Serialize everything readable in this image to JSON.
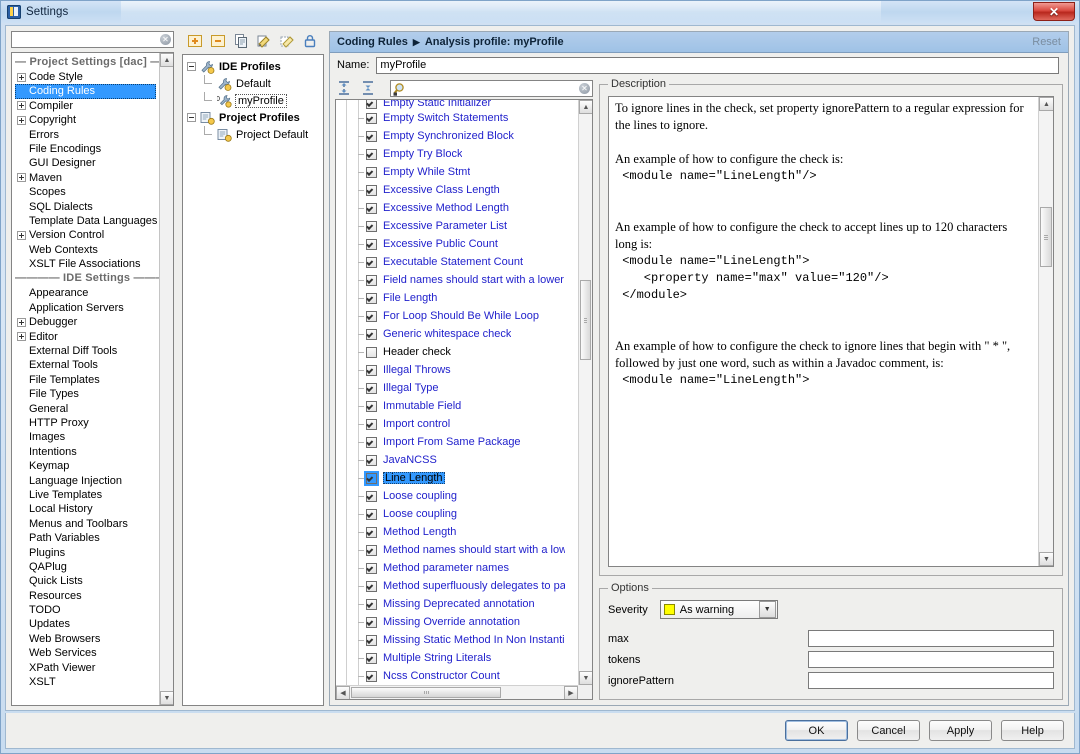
{
  "window": {
    "title": "Settings",
    "app_icon": "intellij-icon",
    "close_label": "✕"
  },
  "sidebar": {
    "search": {
      "value": "",
      "placeholder": ""
    },
    "clear_icon": "clear-circle-icon",
    "group_header_project": "— Project Settings [dac] —",
    "group_header_ide": "———— IDE Settings ————",
    "project_items": [
      {
        "label": "Code Style",
        "expandable": true,
        "selected": false
      },
      {
        "label": "Coding Rules",
        "expandable": false,
        "selected": true
      },
      {
        "label": "Compiler",
        "expandable": true,
        "selected": false
      },
      {
        "label": "Copyright",
        "expandable": true,
        "selected": false
      },
      {
        "label": "Errors",
        "expandable": false,
        "selected": false
      },
      {
        "label": "File Encodings",
        "expandable": false,
        "selected": false
      },
      {
        "label": "GUI Designer",
        "expandable": false,
        "selected": false
      },
      {
        "label": "Maven",
        "expandable": true,
        "selected": false
      },
      {
        "label": "Scopes",
        "expandable": false,
        "selected": false
      },
      {
        "label": "SQL Dialects",
        "expandable": false,
        "selected": false
      },
      {
        "label": "Template Data Languages",
        "expandable": false,
        "selected": false
      },
      {
        "label": "Version Control",
        "expandable": true,
        "selected": false
      },
      {
        "label": "Web Contexts",
        "expandable": false,
        "selected": false
      },
      {
        "label": "XSLT File Associations",
        "expandable": false,
        "selected": false
      }
    ],
    "ide_items": [
      {
        "label": "Appearance",
        "expandable": false
      },
      {
        "label": "Application Servers",
        "expandable": false
      },
      {
        "label": "Debugger",
        "expandable": true
      },
      {
        "label": "Editor",
        "expandable": true
      },
      {
        "label": "External Diff Tools",
        "expandable": false
      },
      {
        "label": "External Tools",
        "expandable": false
      },
      {
        "label": "File Templates",
        "expandable": false
      },
      {
        "label": "File Types",
        "expandable": false
      },
      {
        "label": "General",
        "expandable": false
      },
      {
        "label": "HTTP Proxy",
        "expandable": false
      },
      {
        "label": "Images",
        "expandable": false
      },
      {
        "label": "Intentions",
        "expandable": false
      },
      {
        "label": "Keymap",
        "expandable": false
      },
      {
        "label": "Language Injection",
        "expandable": false
      },
      {
        "label": "Live Templates",
        "expandable": false
      },
      {
        "label": "Local History",
        "expandable": false
      },
      {
        "label": "Menus and Toolbars",
        "expandable": false
      },
      {
        "label": "Path Variables",
        "expandable": false
      },
      {
        "label": "Plugins",
        "expandable": false
      },
      {
        "label": "QAPlug",
        "expandable": false
      },
      {
        "label": "Quick Lists",
        "expandable": false
      },
      {
        "label": "Resources",
        "expandable": false
      },
      {
        "label": "TODO",
        "expandable": false
      },
      {
        "label": "Updates",
        "expandable": false
      },
      {
        "label": "Web Browsers",
        "expandable": false
      },
      {
        "label": "Web Services",
        "expandable": false
      },
      {
        "label": "XPath Viewer",
        "expandable": false
      },
      {
        "label": "XSLT",
        "expandable": false
      }
    ]
  },
  "profiles": {
    "toolbar": [
      {
        "name": "add-profile-button",
        "icon": "plus-icon"
      },
      {
        "name": "remove-profile-button",
        "icon": "minus-icon"
      },
      {
        "name": "copy-profile-button",
        "icon": "copy-icon"
      },
      {
        "name": "import-profile-button",
        "icon": "import-icon"
      },
      {
        "name": "export-profile-button",
        "icon": "export-icon"
      },
      {
        "name": "lock-profile-button",
        "icon": "lock-icon"
      }
    ],
    "tree": [
      {
        "label": "IDE Profiles",
        "level": 0,
        "bold": true,
        "icon": "wrench-icon",
        "expanded": true
      },
      {
        "label": "Default",
        "level": 1,
        "bold": false,
        "icon": "wrench-icon"
      },
      {
        "label": "myProfile",
        "level": 1,
        "bold": false,
        "icon": "wrench-edit-icon",
        "boxed": true
      },
      {
        "label": "Project Profiles",
        "level": 0,
        "bold": true,
        "icon": "project-icon",
        "expanded": true
      },
      {
        "label": "Project Default",
        "level": 1,
        "bold": false,
        "icon": "project-icon"
      }
    ]
  },
  "main": {
    "breadcrumb": {
      "root": "Coding Rules",
      "separator": "▶",
      "leaf": "Analysis profile: myProfile"
    },
    "reset_label": "Reset",
    "name_label": "Name:",
    "name_value": "myProfile",
    "rules_toolbar": {
      "expand_all_icon": "expand-all-icon",
      "collapse_all_icon": "collapse-all-icon",
      "filter_value": "",
      "filter_placeholder": "",
      "search_icon": "search-icon",
      "clear_icon": "clear-circle-icon"
    },
    "rules": [
      {
        "label": "Empty Switch Statements",
        "checked": true,
        "selected": false,
        "clipped": false
      },
      {
        "label": "Empty Synchronized Block",
        "checked": true,
        "selected": false,
        "clipped": false
      },
      {
        "label": "Empty Try Block",
        "checked": true,
        "selected": false,
        "clipped": false
      },
      {
        "label": "Empty While Stmt",
        "checked": true,
        "selected": false,
        "clipped": false
      },
      {
        "label": "Excessive Class Length",
        "checked": true,
        "selected": false,
        "clipped": false
      },
      {
        "label": "Excessive Method Length",
        "checked": true,
        "selected": false,
        "clipped": false
      },
      {
        "label": "Excessive Parameter List",
        "checked": true,
        "selected": false,
        "clipped": false
      },
      {
        "label": "Excessive Public Count",
        "checked": true,
        "selected": false,
        "clipped": false
      },
      {
        "label": "Executable Statement Count",
        "checked": true,
        "selected": false,
        "clipped": false
      },
      {
        "label": "Field names should start with a lower case letter",
        "checked": true,
        "selected": false,
        "clipped": true
      },
      {
        "label": "File Length",
        "checked": true,
        "selected": false,
        "clipped": false
      },
      {
        "label": "For Loop Should Be While Loop",
        "checked": true,
        "selected": false,
        "clipped": false
      },
      {
        "label": "Generic whitespace check",
        "checked": true,
        "selected": false,
        "clipped": false
      },
      {
        "label": "Header check",
        "checked": false,
        "selected": false,
        "clipped": false,
        "plain": true
      },
      {
        "label": "Illegal Throws",
        "checked": true,
        "selected": false,
        "clipped": false
      },
      {
        "label": "Illegal Type",
        "checked": true,
        "selected": false,
        "clipped": false
      },
      {
        "label": "Immutable Field",
        "checked": true,
        "selected": false,
        "clipped": false
      },
      {
        "label": "Import control",
        "checked": true,
        "selected": false,
        "clipped": false
      },
      {
        "label": "Import From Same Package",
        "checked": true,
        "selected": false,
        "clipped": false
      },
      {
        "label": "JavaNCSS",
        "checked": true,
        "selected": false,
        "clipped": false
      },
      {
        "label": "Line Length",
        "checked": true,
        "selected": true,
        "clipped": false
      },
      {
        "label": "Loose coupling",
        "checked": true,
        "selected": false,
        "clipped": false
      },
      {
        "label": "Loose coupling",
        "checked": true,
        "selected": false,
        "clipped": false
      },
      {
        "label": "Method Length",
        "checked": true,
        "selected": false,
        "clipped": false
      },
      {
        "label": "Method names should start with a lower case letter",
        "checked": true,
        "selected": false,
        "clipped": true
      },
      {
        "label": "Method parameter names",
        "checked": true,
        "selected": false,
        "clipped": false
      },
      {
        "label": "Method superfluously delegates to parent",
        "checked": true,
        "selected": false,
        "clipped": true
      },
      {
        "label": "Missing Deprecated annotation",
        "checked": true,
        "selected": false,
        "clipped": false
      },
      {
        "label": "Missing Override annotation",
        "checked": true,
        "selected": false,
        "clipped": false
      },
      {
        "label": "Missing Static Method In Non Instantiatable Class",
        "checked": true,
        "selected": false,
        "clipped": true
      },
      {
        "label": "Multiple String Literals",
        "checked": true,
        "selected": false,
        "clipped": false
      },
      {
        "label": "Ncss Constructor Count",
        "checked": true,
        "selected": false,
        "clipped": false
      }
    ],
    "description": {
      "legend": "Description",
      "paragraphs": [
        {
          "type": "text",
          "text": "To ignore lines in the check, set property ignorePattern to a regular expression for the lines to ignore."
        },
        {
          "type": "blank"
        },
        {
          "type": "text",
          "text": "An example of how to configure the check is:"
        },
        {
          "type": "code",
          "text": " <module name=\"LineLength\"/>"
        },
        {
          "type": "blank"
        },
        {
          "type": "blank"
        },
        {
          "type": "text",
          "text": "An example of how to configure the check to accept lines up to 120 characters long is:"
        },
        {
          "type": "code",
          "text": " <module name=\"LineLength\">\n    <property name=\"max\" value=\"120\"/>\n </module>"
        },
        {
          "type": "blank"
        },
        {
          "type": "blank"
        },
        {
          "type": "text",
          "text": "An example of how to configure the check to ignore lines that begin with \" * \", followed by just one word, such as within a Javadoc comment, is:"
        },
        {
          "type": "code",
          "text": " <module name=\"LineLength\">"
        }
      ]
    },
    "options": {
      "legend": "Options",
      "severity_label": "Severity",
      "severity_value": "As warning",
      "severity_color": "#ffff00",
      "fields": [
        {
          "label": "max",
          "value": ""
        },
        {
          "label": "tokens",
          "value": ""
        },
        {
          "label": "ignorePattern",
          "value": ""
        }
      ]
    }
  },
  "footer": {
    "buttons": [
      {
        "label": "OK",
        "default": true
      },
      {
        "label": "Cancel",
        "default": false
      },
      {
        "label": "Apply",
        "default": false
      },
      {
        "label": "Help",
        "default": false
      }
    ]
  }
}
